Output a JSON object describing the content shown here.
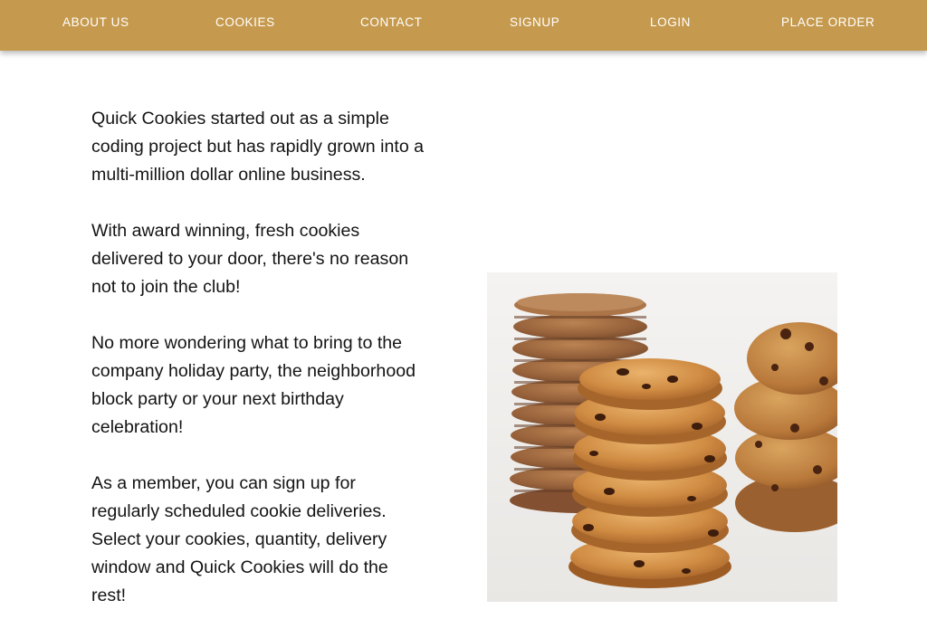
{
  "nav": {
    "items": [
      {
        "label": "ABOUT US"
      },
      {
        "label": "COOKIES"
      },
      {
        "label": "CONTACT"
      },
      {
        "label": "SIGNUP"
      },
      {
        "label": "LOGIN"
      },
      {
        "label": "PLACE ORDER"
      }
    ]
  },
  "colors": {
    "nav_background": "#c69a4e",
    "nav_text": "#ffffff",
    "body_text": "#141414"
  },
  "main": {
    "paragraphs": [
      "Quick Cookies started out as a simple coding project but has rapidly grown into a multi-million dollar online business.",
      "With award winning, fresh cookies delivered to your door, there's no reason not to join the club!",
      "No more wondering what to bring to the company holiday party, the neighborhood block party or your next birthday celebration!",
      "As a member, you can sign up for regularly scheduled cookie deliveries. Select your cookies, quantity, delivery window and Quick Cookies will do the rest!"
    ]
  }
}
